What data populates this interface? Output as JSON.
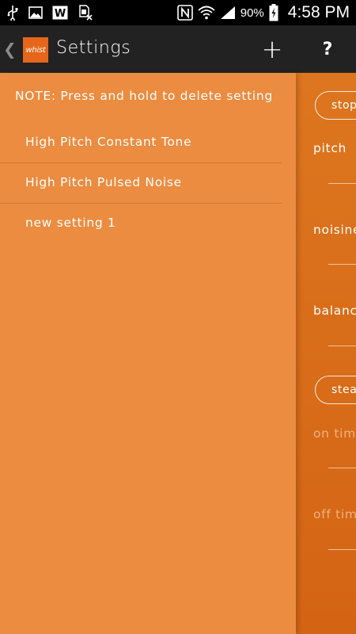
{
  "status_bar": {
    "icons": [
      "usb-icon",
      "image-icon",
      "w-app-icon",
      "sim-x-icon",
      "nfc-icon",
      "wifi-icon",
      "signal-icon",
      "battery-icon"
    ],
    "battery": "90%",
    "time": "4:58 PM"
  },
  "action_bar": {
    "back_glyph": "❮",
    "logo_text": "whist",
    "title": "Settings",
    "add_glyph": "+",
    "help_glyph": "?"
  },
  "drawer": {
    "note": "NOTE: Press and hold to delete setting",
    "items": [
      {
        "label": "High Pitch Constant Tone"
      },
      {
        "label": "High Pitch Pulsed Noise"
      },
      {
        "label": "new setting 1"
      }
    ]
  },
  "main": {
    "stop_button": "stop",
    "pitch_label": "pitch",
    "noise_label": "noisiness",
    "balance_label": "balance",
    "mode_button": "steady",
    "on_time_label": "on time",
    "off_time_label": "off time"
  },
  "colors": {
    "drawer_bg": "#eb8c40",
    "main_bg": "#d86a1c",
    "action_bar_bg": "#222222",
    "accent": "#e6661b"
  }
}
